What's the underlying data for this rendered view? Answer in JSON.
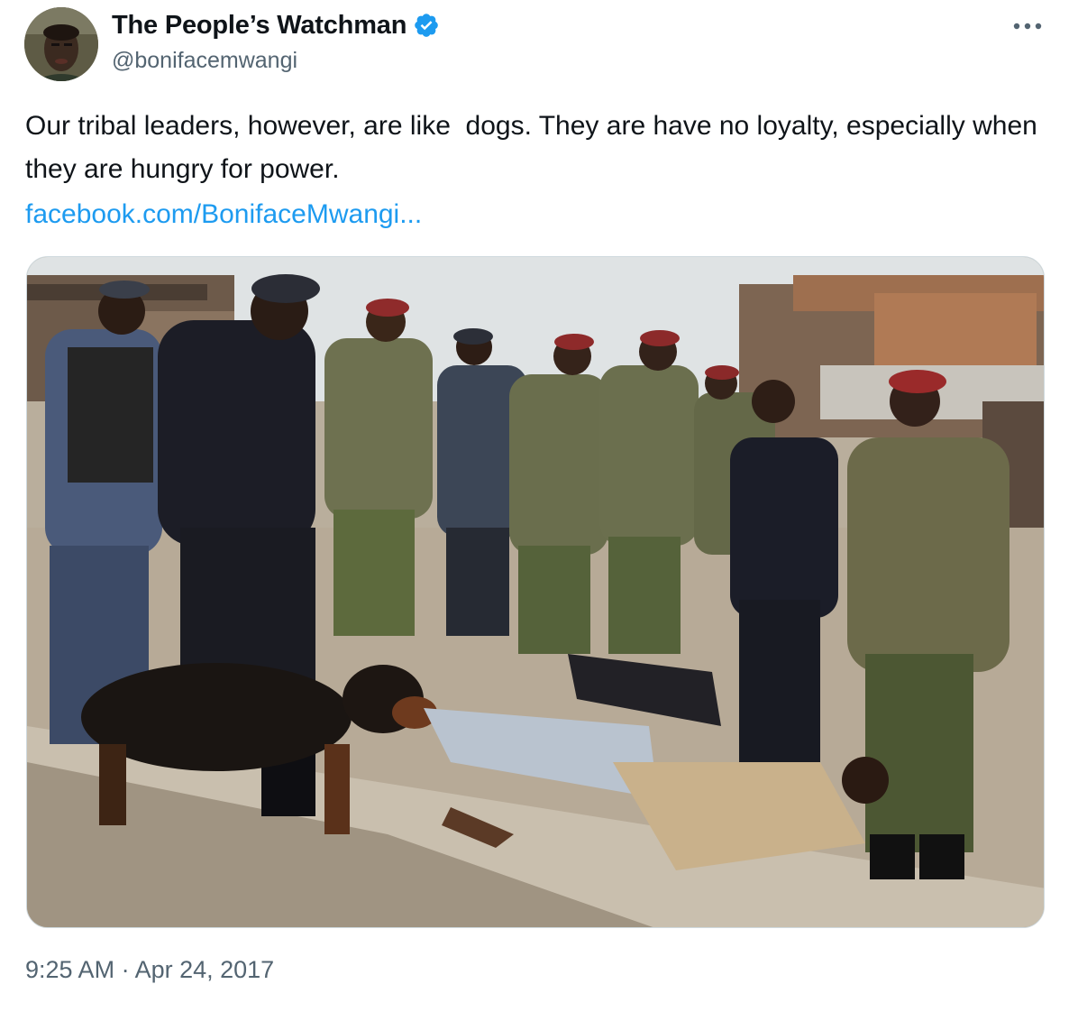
{
  "author": {
    "display_name": "The People’s Watchman",
    "handle": "@bonifacemwangi",
    "verified": true,
    "verified_icon": "verified-badge-icon",
    "verified_color": "#1d9bf0"
  },
  "tweet": {
    "text": "Our tribal leaders, however, are like  dogs. They are have no loyalty, especially when they are hungry for power.",
    "link": "facebook.com/BonifaceMwangi...",
    "timestamp": "9:25 AM · Apr 24, 2017"
  },
  "actions": {
    "more_icon": "more-options-icon"
  },
  "colors": {
    "text": "#0f1419",
    "secondary": "#536471",
    "link": "#1d9bf0",
    "border": "#cfd9de"
  }
}
